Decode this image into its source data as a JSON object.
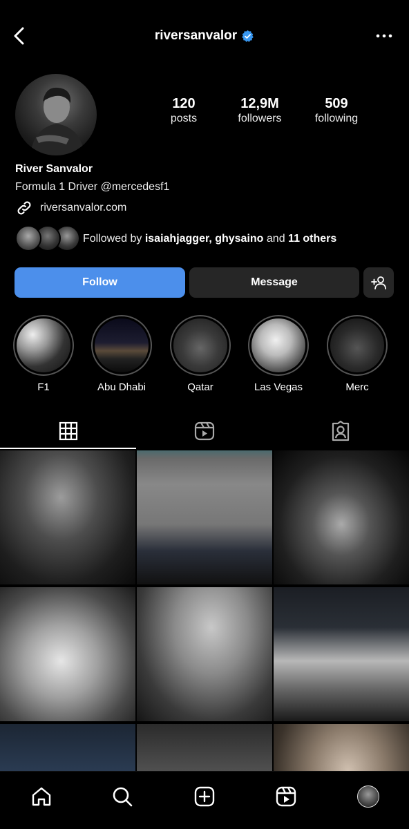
{
  "header": {
    "username": "riversanvalor",
    "back_icon": "chevron-left-icon",
    "more_icon": "more-horizontal-icon",
    "verified_color": "#3897f0"
  },
  "profile": {
    "stats": [
      {
        "value": "120",
        "label": "posts"
      },
      {
        "value": "12,9M",
        "label": "followers"
      },
      {
        "value": "509",
        "label": "following"
      }
    ],
    "name": "River Sanvalor",
    "bio": "Formula 1 Driver @mercedesf1",
    "link": "riversanvalor.com",
    "followed_by": {
      "prefix": "Followed by ",
      "users": "isaiahjagger, ghysaino",
      "middle": " and ",
      "others": "11 others"
    }
  },
  "actions": {
    "follow": "Follow",
    "message": "Message",
    "add_icon": "add-person-icon",
    "follow_color": "#4c8feb"
  },
  "highlights": [
    {
      "label": "F1"
    },
    {
      "label": "Abu Dhabi"
    },
    {
      "label": "Qatar"
    },
    {
      "label": "Las Vegas"
    },
    {
      "label": "Merc"
    }
  ],
  "tabs": [
    {
      "icon": "grid-icon",
      "active": true
    },
    {
      "icon": "reels-icon",
      "active": false
    },
    {
      "icon": "tagged-icon",
      "active": false
    }
  ],
  "bottom_nav": [
    "home-icon",
    "search-icon",
    "create-icon",
    "reels-icon",
    "profile-avatar"
  ]
}
